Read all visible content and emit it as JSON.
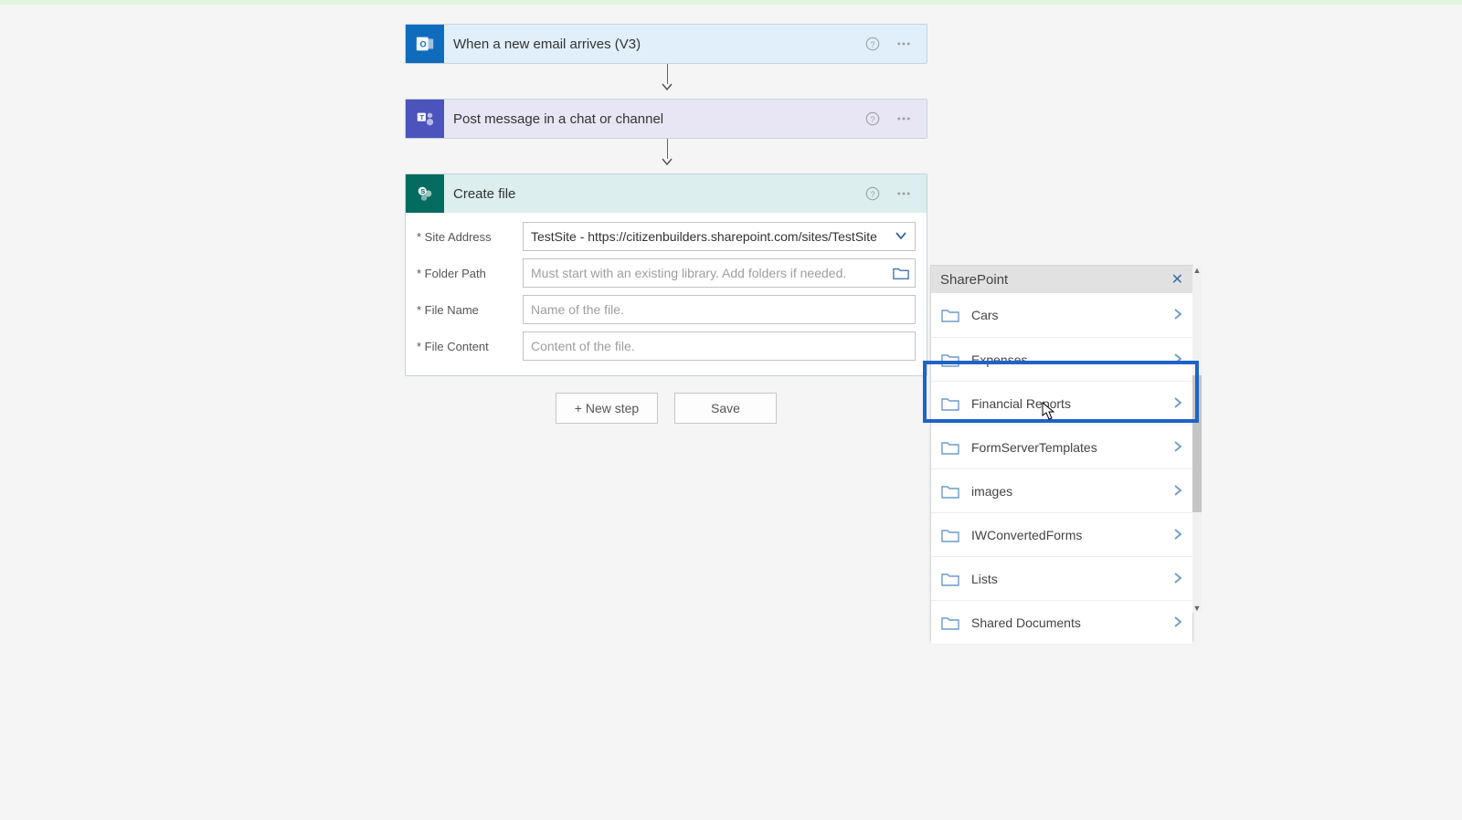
{
  "colors": {
    "outlook": "#0f6cbd",
    "teams": "#4b53bc",
    "sharepoint": "#036b5f",
    "highlight": "#1f63c9"
  },
  "trigger": {
    "title": "When a new email arrives (V3)"
  },
  "teams": {
    "title": "Post message in a chat or channel"
  },
  "sp_action": {
    "title": "Create file",
    "fields": {
      "site_label": "* Site Address",
      "site_value": "TestSite - https://citizenbuilders.sharepoint.com/sites/TestSite",
      "folder_label": "* Folder Path",
      "folder_placeholder": "Must start with an existing library. Add folders if needed.",
      "file_name_label": "* File Name",
      "file_name_placeholder": "Name of the file.",
      "file_content_label": "* File Content",
      "file_content_placeholder": "Content of the file."
    }
  },
  "buttons": {
    "new_step": "+ New step",
    "save": "Save"
  },
  "picker": {
    "title": "SharePoint",
    "items": [
      "Cars",
      "Expenses",
      "Financial Reports",
      "FormServerTemplates",
      "images",
      "IWConvertedForms",
      "Lists",
      "Shared Documents"
    ],
    "highlighted_index": 2
  }
}
